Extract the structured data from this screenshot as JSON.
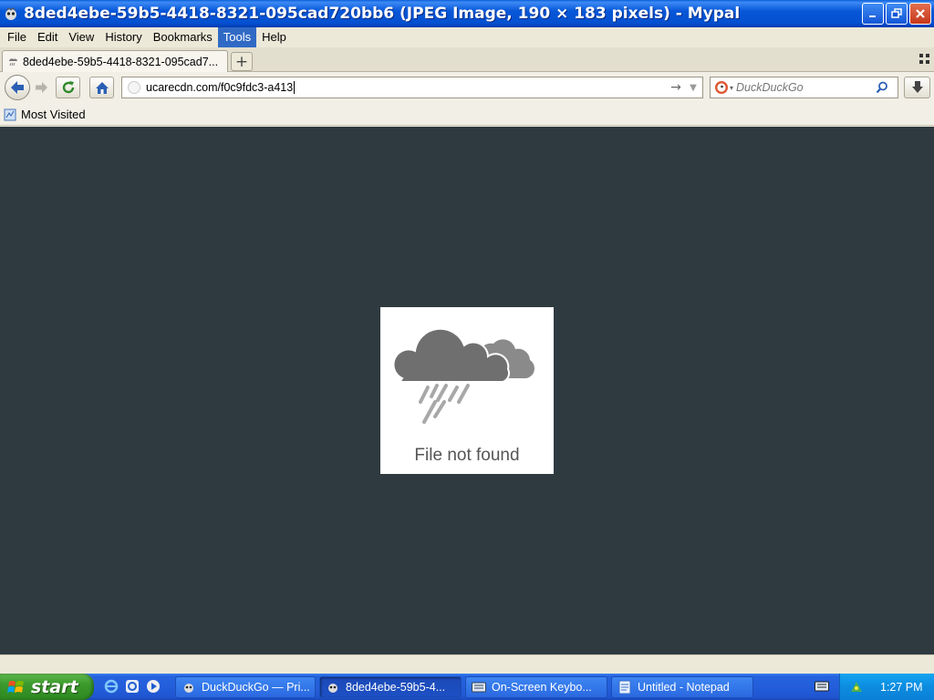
{
  "window": {
    "title": "8ded4ebe-59b5-4418-8321-095cad720bb6 (JPEG Image, 190 × 183 pixels) - Mypal"
  },
  "menu": {
    "items": [
      {
        "label": "File"
      },
      {
        "label": "Edit"
      },
      {
        "label": "View"
      },
      {
        "label": "History"
      },
      {
        "label": "Bookmarks"
      },
      {
        "label": "Tools"
      },
      {
        "label": "Help"
      }
    ]
  },
  "tabs": {
    "active_label": "8ded4ebe-59b5-4418-8321-095cad7...",
    "new_tab_label": "+"
  },
  "nav": {
    "url": "ucarecdn.com/f0c9fdc3-a413",
    "search_placeholder": "DuckDuckGo"
  },
  "bookmarks": {
    "items": [
      {
        "label": "Most Visited"
      }
    ]
  },
  "content": {
    "image_text": "File not found"
  },
  "taskbar": {
    "start_label": "start",
    "tasks": [
      {
        "label": "DuckDuckGo — Pri..."
      },
      {
        "label": "8ded4ebe-59b5-4..."
      },
      {
        "label": "On-Screen Keybo..."
      },
      {
        "label": "Untitled - Notepad"
      }
    ],
    "clock": "1:27 PM"
  },
  "colors": {
    "content_bg": "#2f3a40",
    "menu_highlight": "#316ac5",
    "titlebar_blue": "#0757d8",
    "start_green": "#3c9a2c"
  }
}
